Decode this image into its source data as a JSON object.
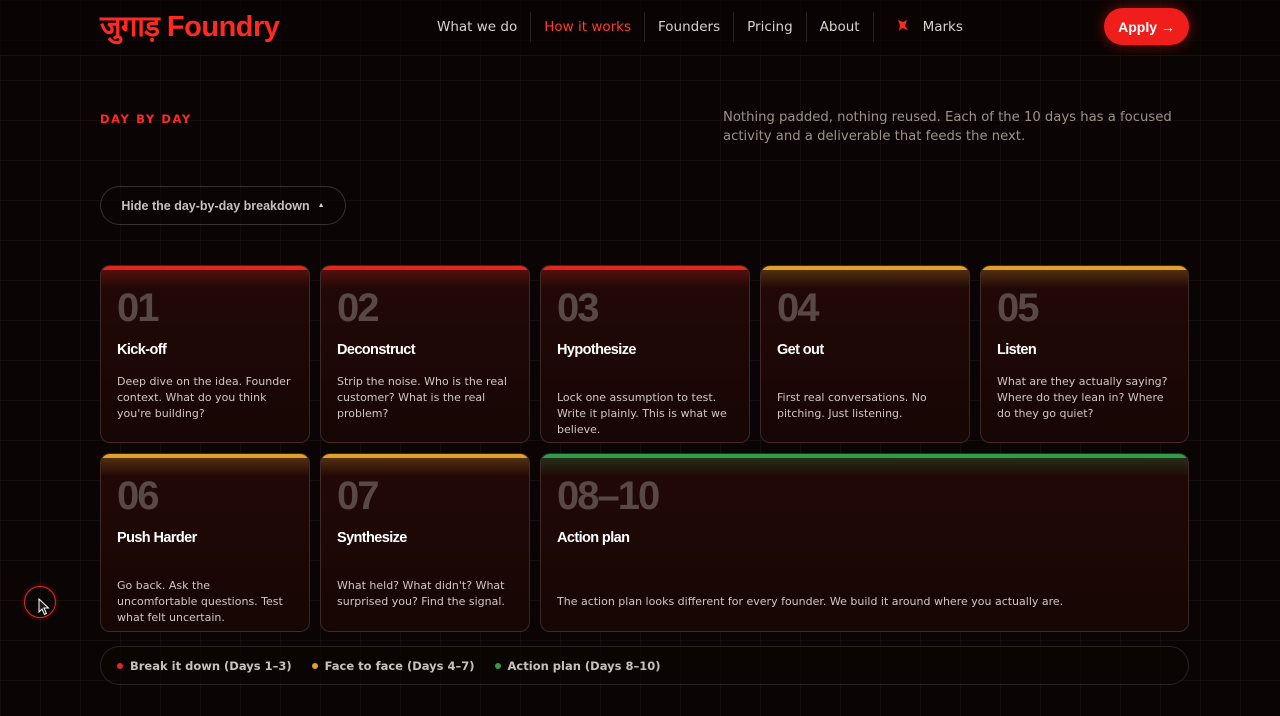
{
  "header": {
    "logo": "जुगाड़ Foundry",
    "nav": [
      {
        "label": "What we do",
        "active": false
      },
      {
        "label": "How it works",
        "active": true
      },
      {
        "label": "Founders",
        "active": false
      },
      {
        "label": "Pricing",
        "active": false
      },
      {
        "label": "About",
        "active": false
      },
      {
        "label": "Marks",
        "active": false,
        "icon": "marks-icon"
      }
    ],
    "apply_label": "Apply →"
  },
  "section": {
    "eyebrow": "DAY BY DAY",
    "intro": "Nothing padded, nothing reused. Each of the 10 days has a focused activity and a deliverable that feeds the next.",
    "toggle_label": "Hide the day-by-day breakdown",
    "toggle_icon": "caret-up-icon"
  },
  "days": [
    {
      "num": "01",
      "title": "Kick-off",
      "desc": "Deep dive on the idea. Founder context. What do you think you're building?",
      "phase": "red"
    },
    {
      "num": "02",
      "title": "Deconstruct",
      "desc": "Strip the noise. Who is the real customer? What is the real problem?",
      "phase": "red"
    },
    {
      "num": "03",
      "title": "Hypothesize",
      "desc": "Lock one assumption to test. Write it plainly. This is what we believe.",
      "phase": "red"
    },
    {
      "num": "04",
      "title": "Get out",
      "desc": "First real conversations. No pitching. Just listening.",
      "phase": "amber"
    },
    {
      "num": "05",
      "title": "Listen",
      "desc": "What are they actually saying? Where do they lean in? Where do they go quiet?",
      "phase": "amber"
    },
    {
      "num": "06",
      "title": "Push Harder",
      "desc": "Go back. Ask the uncomfortable questions. Test what felt uncertain.",
      "phase": "amber"
    },
    {
      "num": "07",
      "title": "Synthesize",
      "desc": "What held? What didn't? What surprised you? Find the signal.",
      "phase": "amber"
    },
    {
      "num": "08–10",
      "title": "Action plan",
      "desc": "The action plan looks different for every founder. We build it around where you actually are.",
      "phase": "green"
    }
  ],
  "legend": [
    {
      "label": "Break it down (Days 1–3)",
      "color": "#e2261e"
    },
    {
      "label": "Face to face (Days 4–7)",
      "color": "#e0a02a"
    },
    {
      "label": "Action plan (Days 8–10)",
      "color": "#2f9c4a"
    }
  ],
  "colors": {
    "accent": "#ff2a24",
    "red": "#e2261e",
    "amber": "#e0a02a",
    "green": "#2f9c4a"
  }
}
